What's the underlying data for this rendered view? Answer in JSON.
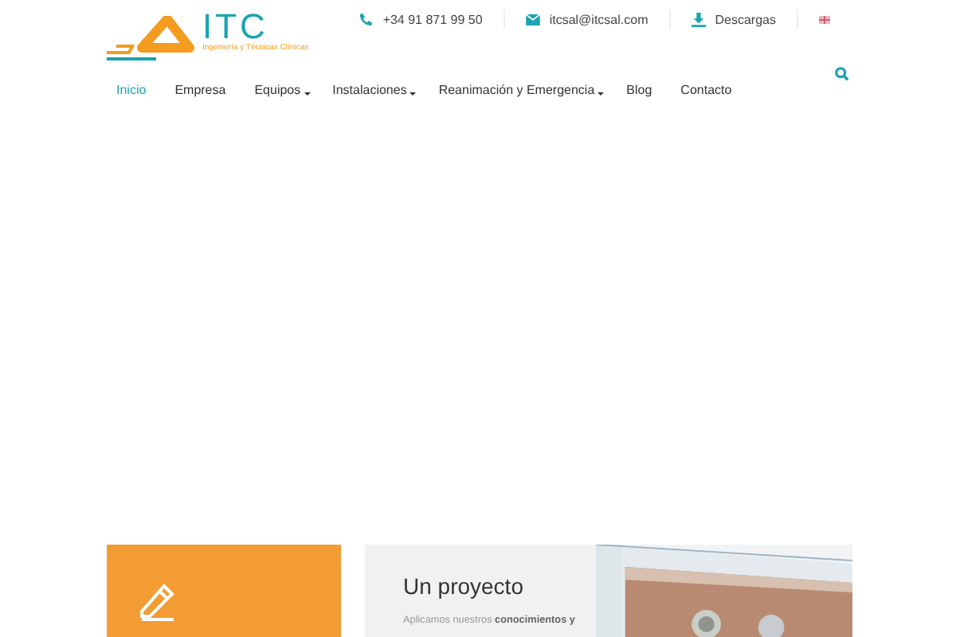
{
  "logo": {
    "name": "ITC",
    "tagline": "Ingeniería y Técnicas Clínicas"
  },
  "contacts": [
    {
      "kind": "phone",
      "text": "+34 91 871 99 50"
    },
    {
      "kind": "email",
      "text": "itcsal@itcsal.com"
    },
    {
      "kind": "download",
      "text": "Descargas"
    }
  ],
  "nav": [
    {
      "label": "Inicio",
      "selected": true,
      "submenu": false
    },
    {
      "label": "Empresa",
      "selected": false,
      "submenu": false
    },
    {
      "label": "Equipos",
      "selected": false,
      "submenu": true
    },
    {
      "label": "Instalaciones",
      "selected": false,
      "submenu": true
    },
    {
      "label": "Reanimación y Emergencia",
      "selected": false,
      "submenu": true
    },
    {
      "label": "Blog",
      "selected": false,
      "submenu": false
    },
    {
      "label": "Contacto",
      "selected": false,
      "submenu": false
    }
  ],
  "feature": {
    "title": "Un proyecto",
    "text": "Aplicamos nuestros **conocimientos y**"
  }
}
